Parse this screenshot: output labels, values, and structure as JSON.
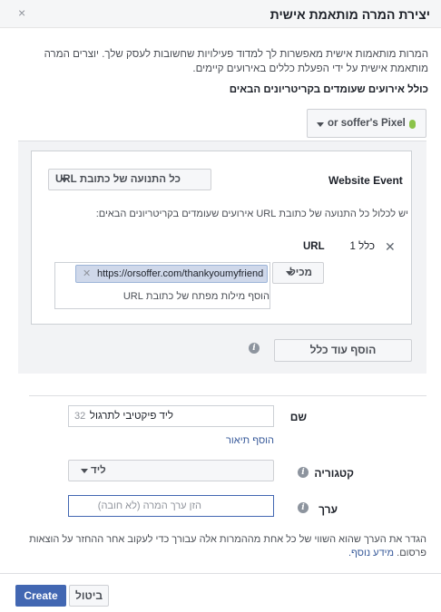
{
  "dialog": {
    "title": "יצירת המרה מותאמת אישית",
    "close_glyph": "×"
  },
  "intro": {
    "description": "המרות מותאמות אישית מאפשרות לך למדוד פעילויות שחשובות לעסק שלך. יוצרים המרה מותאמת אישית על ידי הפעלת כללים באירועים קיימים.",
    "section_heading": "כולל אירועים שעומדים בקריטריונים הבאים"
  },
  "pixel": {
    "label": "or soffer's Pixel",
    "status_color": "#8bc34a"
  },
  "rules": {
    "website_event_label": "Website Event",
    "event_dropdown": "כל התנועה של כתובת URL",
    "hint": "יש לכלול כל התנועה של כתובת URL אירועים שעומדים בקריטריונים הבאים:",
    "rule_number": "כלל 1",
    "rule_field": "URL",
    "operator": "מכיל",
    "url_token": "https://orsoffer.com/thankyoumyfriend",
    "add_keyword_hint": "הוסף מילות מפתח של כתובת URL",
    "add_rule_button": "הוסף עוד כלל"
  },
  "form": {
    "name_label": "שם",
    "name_value": "ליד פיקטיבי לתרגול",
    "name_counter": "32",
    "add_description_link": "הוסף תיאור",
    "category_label": "קטגוריה",
    "category_value": "ליד",
    "value_label": "ערך",
    "value_placeholder": "הזן ערך המרה (לא חובה)"
  },
  "footer": {
    "note": "הגדר את הערך שהוא השווי של כל אחת מההמרות אלה עבורך כדי לעקוב אחר ההחזר על הוצאות פרסום.",
    "learn_more": "מידע נוסף.",
    "cancel_button": "ביטול",
    "create_button": "Create"
  },
  "colors": {
    "primary": "#4267b2",
    "link": "#365899",
    "token_bg": "#cfd8ea"
  }
}
